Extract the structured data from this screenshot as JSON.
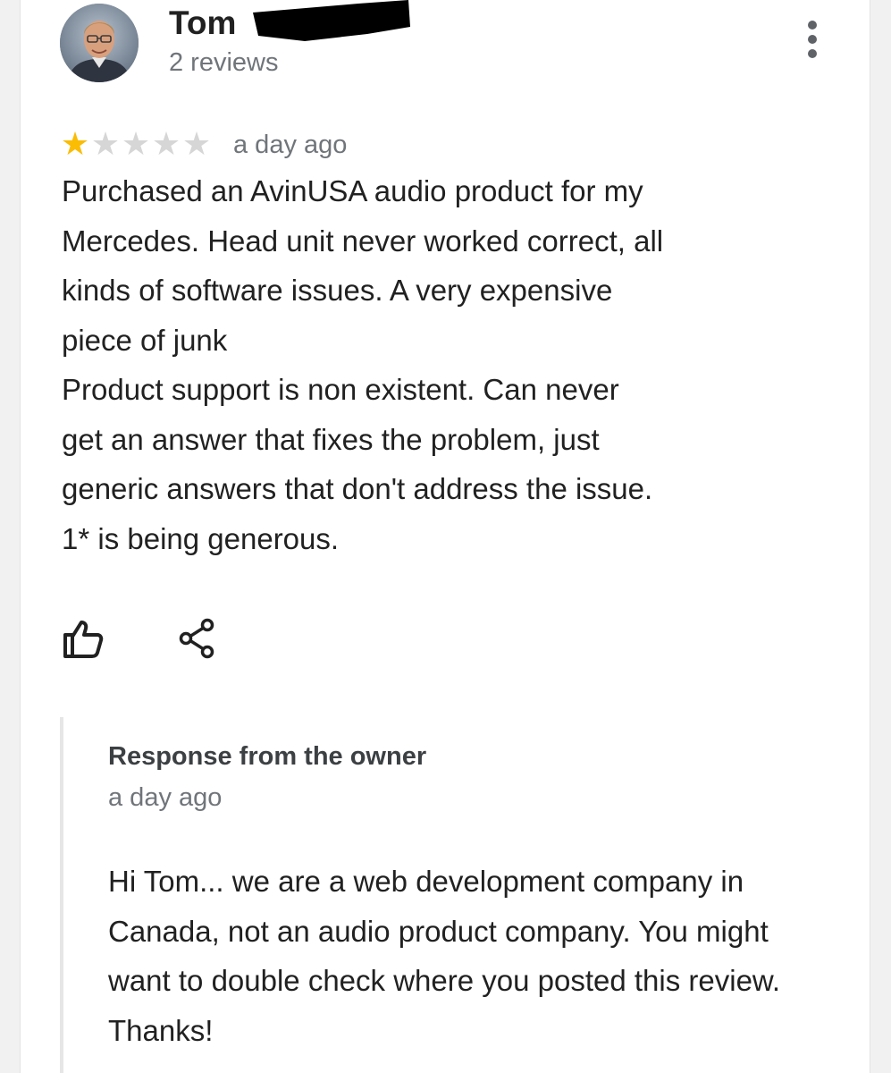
{
  "reviewer": {
    "name": "Tom",
    "review_count": "2 reviews",
    "avatar_icon": "person-photo"
  },
  "review": {
    "rating": 1,
    "rating_max": 5,
    "date": "a day ago",
    "text": "Purchased an AvinUSA audio product for my\nMercedes.  Head unit never worked correct, all\nkinds of software issues.  A very expensive\npiece of junk\nProduct support is non existent.  Can never\nget an answer that fixes the problem, just\ngeneric answers that don't address the issue.\n1* is being generous."
  },
  "actions": {
    "like_icon": "thumbs-up-icon",
    "share_icon": "share-icon",
    "more_icon": "more-vert-icon"
  },
  "owner_response": {
    "title": "Response from the owner",
    "date": "a day ago",
    "text": "Hi Tom... we are a web development company in Canada, not an audio product company. You might want to double check where you posted this review. Thanks!"
  },
  "colors": {
    "star_filled": "#fbbc04",
    "star_empty": "#d6d6d6",
    "secondary_text": "#70757a"
  }
}
